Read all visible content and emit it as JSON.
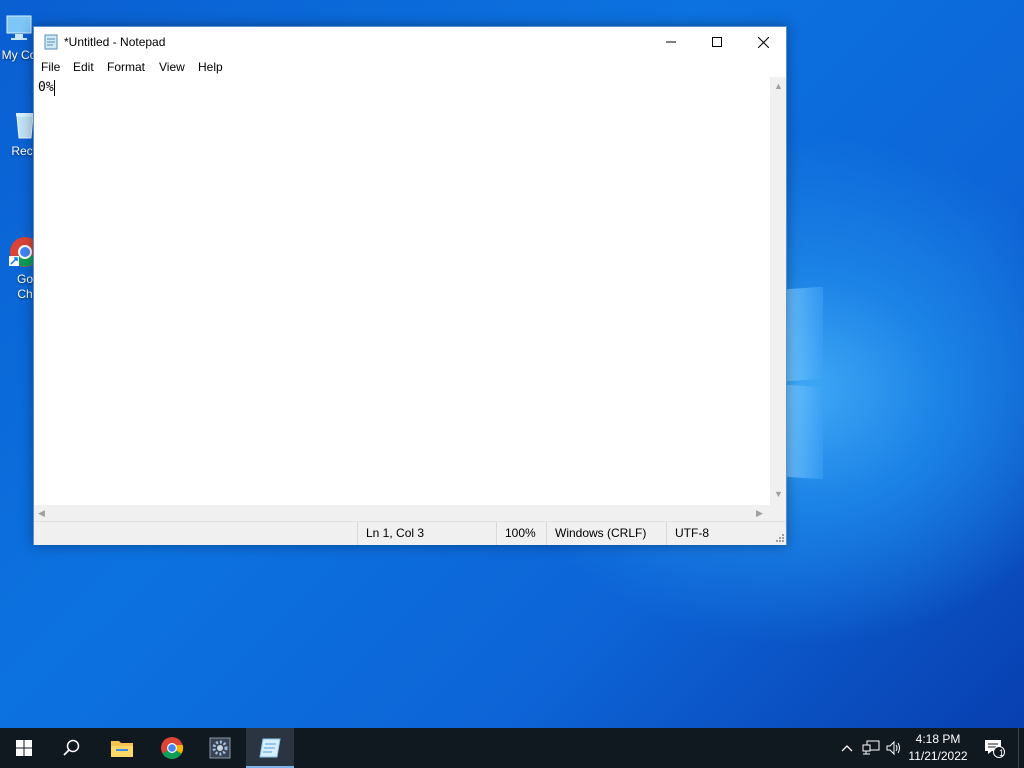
{
  "desktop": {
    "icons": [
      {
        "label": "My Co",
        "icon": "computer-icon"
      },
      {
        "label": "Recy",
        "icon": "recycle-bin-icon"
      },
      {
        "label": "Go\nCh",
        "icon": "chrome-icon"
      }
    ]
  },
  "notepad": {
    "title": "*Untitled - Notepad",
    "menu": [
      "File",
      "Edit",
      "Format",
      "View",
      "Help"
    ],
    "content": "0%",
    "status": {
      "position": "Ln 1, Col 3",
      "zoom": "100%",
      "line_ending": "Windows (CRLF)",
      "encoding": "UTF-8"
    }
  },
  "taskbar": {
    "items": [
      "start-icon",
      "search-icon",
      "file-explorer-icon",
      "chrome-icon",
      "settings-app-icon",
      "notepad-icon"
    ],
    "active": "notepad-icon",
    "clock": {
      "time": "4:18 PM",
      "date": "11/21/2022"
    },
    "notification_count": "1"
  },
  "colors": {
    "accent": "#0c72df",
    "taskbar": "#101820"
  }
}
